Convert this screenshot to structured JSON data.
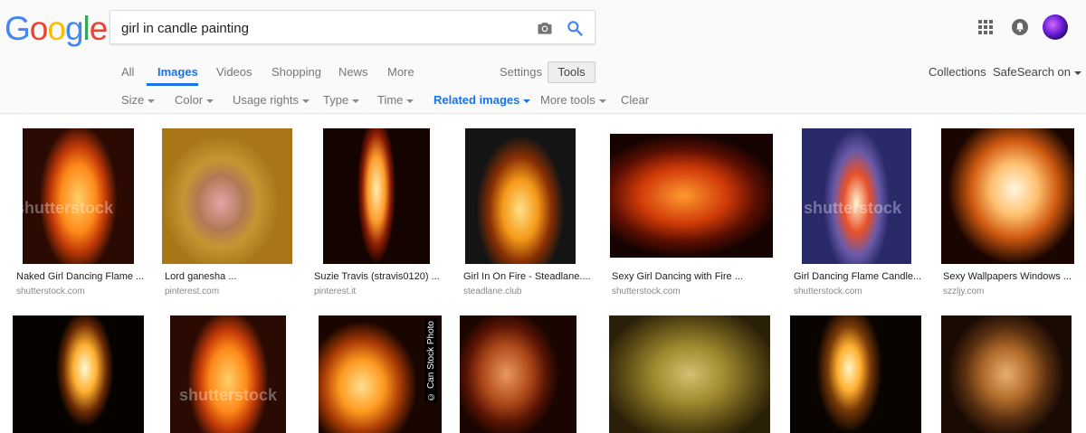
{
  "logo": {
    "letters": [
      "G",
      "o",
      "o",
      "g",
      "l",
      "e"
    ],
    "colors": [
      "#4285F4",
      "#EA4335",
      "#FBBC05",
      "#4285F4",
      "#34A853",
      "#EA4335"
    ]
  },
  "search": {
    "value": "girl in candle painting"
  },
  "icons": {
    "camera": "camera-icon",
    "search": "search-icon",
    "apps": "apps-grid-icon",
    "notifications": "bell-icon"
  },
  "tabs": [
    "All",
    "Images",
    "Videos",
    "Shopping",
    "News",
    "More"
  ],
  "active_tab": "Images",
  "settings_label": "Settings",
  "tools_label": "Tools",
  "collections_label": "Collections",
  "safesearch_label": "SafeSearch on",
  "filters": [
    "Size",
    "Color",
    "Usage rights",
    "Type",
    "Time",
    "Related images",
    "More tools",
    "Clear"
  ],
  "accent": "#1a73e8",
  "results_row1": [
    {
      "caption": "Naked Girl Dancing Flame ...",
      "source": "shutterstock.com",
      "watermark": "shutterstock"
    },
    {
      "caption": "Lord ganesha ...",
      "source": "pinterest.com",
      "watermark": ""
    },
    {
      "caption": "Suzie Travis (stravis0120) ...",
      "source": "pinterest.it",
      "watermark": ""
    },
    {
      "caption": "Girl In On Fire - Steadlane....",
      "source": "steadlane.club",
      "watermark": ""
    },
    {
      "caption": "Sexy Girl Dancing with Fire ...",
      "source": "shutterstock.com",
      "watermark": ""
    },
    {
      "caption": "Girl Dancing Flame Candle...",
      "source": "shutterstock.com",
      "watermark": "shutterstock"
    },
    {
      "caption": "Sexy Wallpapers Windows ...",
      "source": "szzljy.com",
      "watermark": ""
    }
  ],
  "results_row2": [
    {
      "watermark": ""
    },
    {
      "watermark": "shutterstock"
    },
    {
      "watermark": "© Can Stock Photo"
    },
    {
      "watermark": ""
    },
    {
      "watermark": ""
    },
    {
      "watermark": ""
    },
    {
      "watermark": ""
    }
  ]
}
